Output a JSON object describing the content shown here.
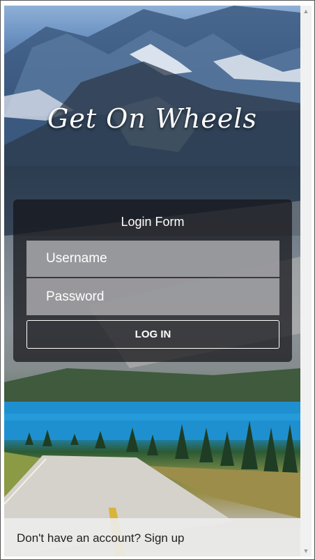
{
  "brand": {
    "title": "Get On Wheels"
  },
  "login_form": {
    "title": "Login Form",
    "username_placeholder": "Username",
    "password_placeholder": "Password",
    "submit_label": "LOG IN"
  },
  "footer": {
    "prompt": "Don't have an account?",
    "signup_label": "Sign up"
  },
  "scrollbar": {
    "up_icon": "chevron-up-icon",
    "down_icon": "chevron-down-icon"
  }
}
